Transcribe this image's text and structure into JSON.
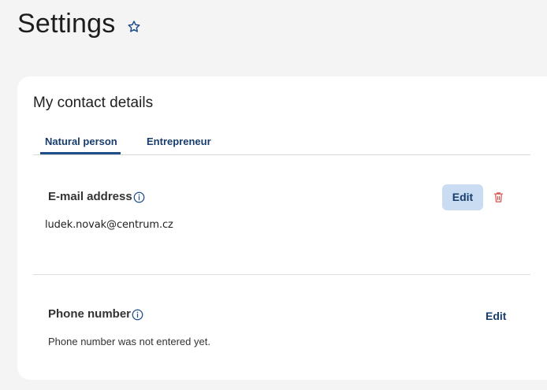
{
  "page": {
    "title": "Settings"
  },
  "icons": {
    "favorite": "star-outline-icon",
    "info": "info-circle-icon",
    "delete": "trash-icon"
  },
  "colors": {
    "primary": "#1e4f8a",
    "primary_text": "#173d6e",
    "button_bg": "#c9dcf1",
    "danger": "#d9534f",
    "page_bg": "#f4f4f4",
    "card_bg": "#ffffff"
  },
  "contact_card": {
    "title": "My contact details",
    "tabs": [
      {
        "label": "Natural person",
        "active": true
      },
      {
        "label": "Entrepreneur",
        "active": false
      }
    ],
    "email": {
      "label": "E-mail address",
      "value": "ludek.novak@centrum.cz",
      "edit_label": "Edit"
    },
    "phone": {
      "label": "Phone number",
      "value": "Phone number was not entered yet.",
      "edit_label": "Edit"
    }
  }
}
